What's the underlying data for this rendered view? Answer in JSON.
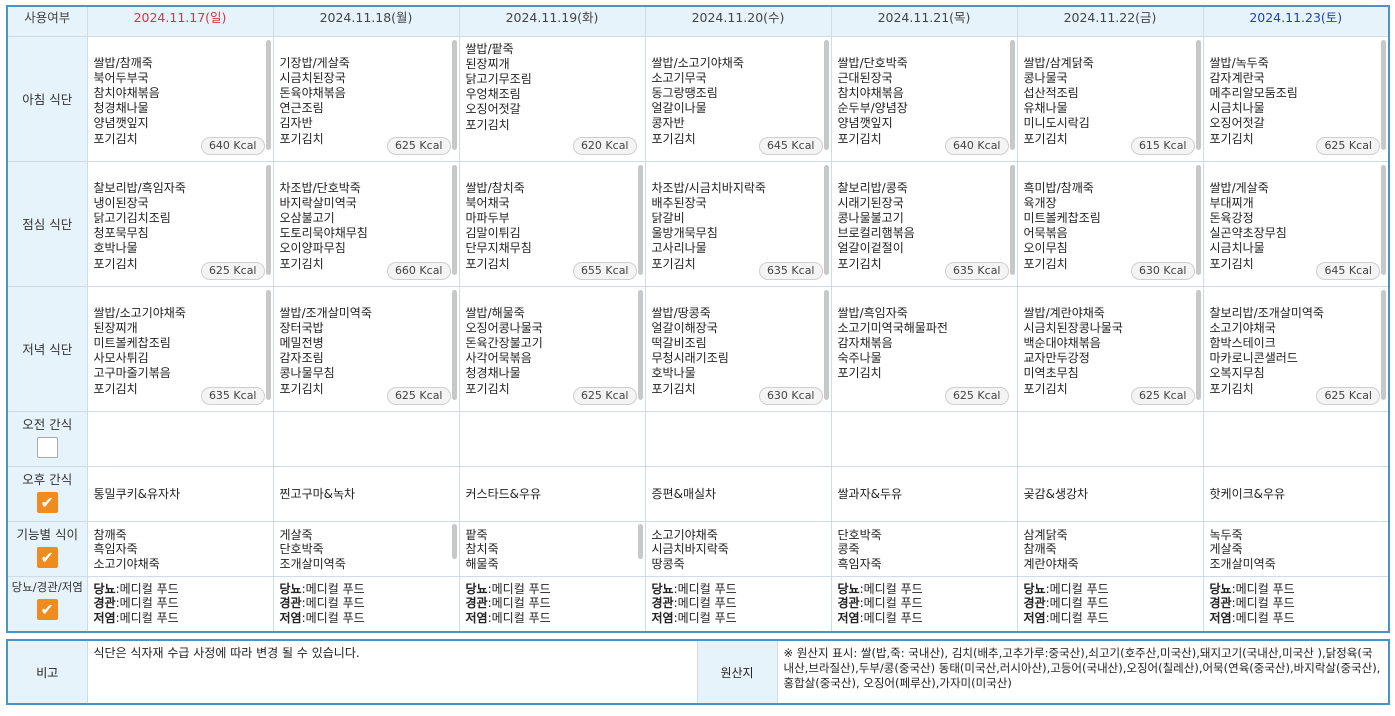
{
  "header": {
    "corner": "사용여부",
    "days": [
      "2024.11.17(일)",
      "2024.11.18(월)",
      "2024.11.19(화)",
      "2024.11.20(수)",
      "2024.11.21(목)",
      "2024.11.22(금)",
      "2024.11.23(토)"
    ]
  },
  "colors": {
    "sunday": "#d6334a",
    "saturday": "#2244aa",
    "accent": "#f08c1e",
    "border": "#4a93c7"
  },
  "rows": {
    "breakfast": {
      "label": "아침 식단",
      "cells": [
        {
          "items": "쌀밥/참깨죽\n북어두부국\n참치야채볶음\n청경채나물\n양념깻잎지\n포기김치",
          "kcal": "640 Kcal"
        },
        {
          "items": "기장밥/게살죽\n시금치된장국\n돈육야채볶음\n연근조림\n김자반\n포기김치",
          "kcal": "625 Kcal"
        },
        {
          "items": "쌀밥/팥죽\n된장찌개\n닭고기무조림\n우엉채조림\n오징어젓갈\n포기김치",
          "kcal": "620 Kcal"
        },
        {
          "items": "쌀밥/소고기야채죽\n소고기무국\n동그랑땡조림\n얼갈이나물\n콩자반\n포기김치",
          "kcal": "645 Kcal"
        },
        {
          "items": "쌀밥/단호박죽\n근대된장국\n참치야채볶음\n순두부/양념장\n양념깻잎지\n포기김치",
          "kcal": "640 Kcal"
        },
        {
          "items": "쌀밥/삼계닭죽\n콩나물국\n섭산적조림\n유채나물\n미니도시락김\n포기김치",
          "kcal": "615 Kcal"
        },
        {
          "items": "쌀밥/녹두죽\n감자계란국\n메추리알모둠조림\n시금치나물\n오징어젓갈\n포기김치",
          "kcal": "625 Kcal"
        }
      ]
    },
    "lunch": {
      "label": "점심 식단",
      "cells": [
        {
          "items": "찰보리밥/흑임자죽\n냉이된장국\n닭고기김치조림\n청포묵무침\n호박나물\n포기김치",
          "kcal": "625 Kcal"
        },
        {
          "items": "차조밥/단호박죽\n바지락살미역국\n오삼불고기\n도토리묵야채무침\n오이양파무침\n포기김치",
          "kcal": "660 Kcal"
        },
        {
          "items": "쌀밥/참치죽\n북어채국\n마파두부\n김말이튀김\n단무지채무침\n포기김치",
          "kcal": "655 Kcal"
        },
        {
          "items": "차조밥/시금치바지락죽\n배추된장국\n닭갈비\n울방개묵무침\n고사리나물\n포기김치",
          "kcal": "635 Kcal"
        },
        {
          "items": "찰보리밥/콩죽\n시래기된장국\n콩나물불고기\n브로컬리햄볶음\n얼갈이겉절이\n포기김치",
          "kcal": "635 Kcal"
        },
        {
          "items": "흑미밥/참깨죽\n육개장\n미트볼케찹조림\n어묵볶음\n오이무침\n포기김치",
          "kcal": "630 Kcal"
        },
        {
          "items": "쌀밥/게살죽\n부대찌개\n돈육강정\n실곤약초장무침\n시금치나물\n포기김치",
          "kcal": "645 Kcal"
        }
      ]
    },
    "dinner": {
      "label": "저녁 식단",
      "cells": [
        {
          "items": "쌀밥/소고기야채죽\n된장찌개\n미트볼케찹조림\n사모사튀김\n고구마줄기볶음\n포기김치",
          "kcal": "635 Kcal"
        },
        {
          "items": "쌀밥/조개살미역죽\n장터국밥\n메밀전병\n감자조림\n콩나물무침\n포기김치",
          "kcal": "625 Kcal"
        },
        {
          "items": "쌀밥/해물죽\n오징어콩나물국\n돈육간장불고기\n사각어묵볶음\n청경채나물\n포기김치",
          "kcal": "625 Kcal"
        },
        {
          "items": "쌀밥/땅콩죽\n얼갈이해장국\n떡갈비조림\n무청시래기조림\n호박나물\n포기김치",
          "kcal": "630 Kcal"
        },
        {
          "items": "쌀밥/흑임자죽\n소고기미역국해물파전\n감자채볶음\n숙주나물\n포기김치",
          "kcal": "625 Kcal"
        },
        {
          "items": "쌀밥/계란야채죽\n시금치된장콩나물국\n백순대야채볶음\n교자만두강정\n미역초무침\n포기김치",
          "kcal": "625 Kcal"
        },
        {
          "items": "찰보리밥/조개살미역죽\n소고기야채국\n함박스테이크\n마카로니콘샐러드\n오복지무침\n포기김치",
          "kcal": "625 Kcal"
        }
      ]
    },
    "am_snack": {
      "label": "오전 간식",
      "checked": false,
      "cells": [
        "",
        "",
        "",
        "",
        "",
        "",
        ""
      ]
    },
    "pm_snack": {
      "label": "오후 간식",
      "checked": true,
      "cells": [
        "통밀쿠키&유자차",
        "찐고구마&녹차",
        "커스타드&우유",
        "증편&매실차",
        "쌀과자&두유",
        "곶감&생강차",
        "핫케이크&우유"
      ]
    },
    "functional": {
      "label": "기능별 식이",
      "checked": true,
      "cells": [
        "참깨죽\n흑임자죽\n소고기야채죽",
        "게살죽\n단호박죽\n조개살미역죽",
        "팥죽\n참치죽\n해물죽",
        "소고기야채죽\n시금치바지락죽\n땅콩죽",
        "단호박죽\n콩죽\n흑임자죽",
        "삼계닭죽\n참깨죽\n계란야채죽",
        "녹두죽\n게살죽\n조개살미역죽"
      ]
    },
    "diet": {
      "label": "당뇨/경관/저염",
      "checked": true,
      "lines": [
        {
          "key": "당뇨",
          "value": ":메디컬 푸드"
        },
        {
          "key": "경관",
          "value": ":메디컬 푸드"
        },
        {
          "key": "저염",
          "value": ":메디컬 푸드"
        }
      ]
    }
  },
  "notes": {
    "label": "비고",
    "text": "식단은 식자재 수급 사정에 따라 변경 될 수 있습니다.",
    "origin_label": "원산지",
    "origin_text": "※ 원산지 표시: 쌀(밥,죽: 국내산), 김치(배추,고추가루:중국산),쇠고기(호주산,미국산),돼지고기(국내산,미국산 ),닭정육(국내산,브라질산),두부/콩(중국산) 동태(미국산,러시아산),고등어(국내산),오징어(칠레산),어묵(연육(중국산),바지락살(중국산),홍합살(중국산), 오징어(페루산),가자미(미국산)"
  }
}
